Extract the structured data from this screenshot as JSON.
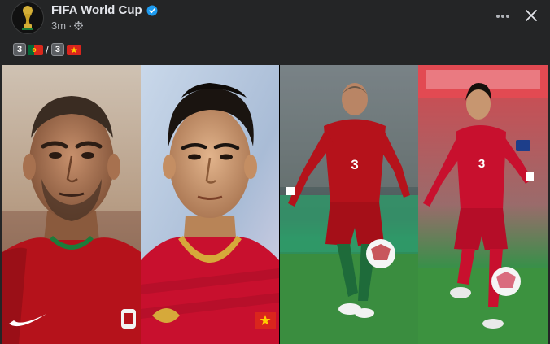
{
  "post": {
    "page_name": "FIFA World Cup",
    "timestamp": "3m",
    "separator": "·",
    "caption": {
      "score_left": "3",
      "slash": "/",
      "score_right": "3"
    }
  },
  "player_left": {
    "shirt_number": "3"
  },
  "player_right": {
    "shirt_number": "3"
  },
  "icons": {
    "verified": "verified-badge-icon",
    "audience": "gear-icon",
    "more": "more-options-icon",
    "close": "close-icon"
  },
  "colors": {
    "background": "#242526",
    "text": "#e4e6eb",
    "muted": "#b0b3b8",
    "verified": "#1d9bf0",
    "portugal_red": "#b5121b",
    "vietnam_red": "#c8102e"
  }
}
